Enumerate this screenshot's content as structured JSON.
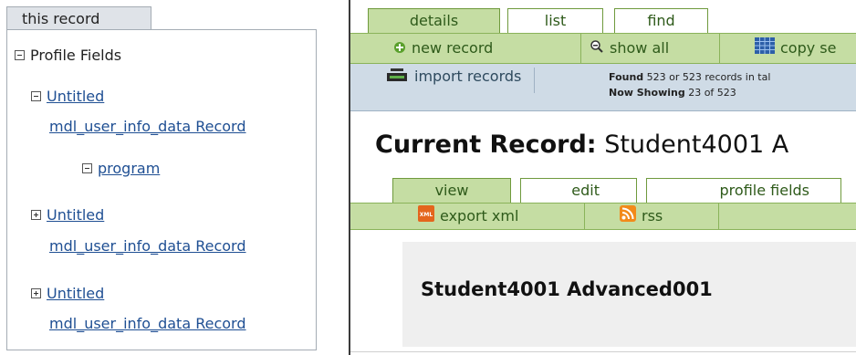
{
  "left_panel": {
    "tab_label": "this record",
    "root": {
      "label": "Profile Fields",
      "expander": "collapse-box-icon"
    },
    "items": [
      {
        "expander": "collapse-box-icon",
        "title": "Untitled",
        "subtitle": "mdl_user_info_data Record"
      },
      {
        "expander": "collapse-box-icon",
        "title": "program"
      },
      {
        "expander": "expand-box-icon",
        "title": "Untitled",
        "subtitle": "mdl_user_info_data Record"
      },
      {
        "expander": "expand-box-icon",
        "title": "Untitled",
        "subtitle": "mdl_user_info_data Record"
      }
    ]
  },
  "main_tabs": [
    {
      "label": "details",
      "active": true
    },
    {
      "label": "list",
      "active": false
    },
    {
      "label": "find",
      "active": false
    }
  ],
  "toolbar": {
    "new_record": "new record",
    "show_all": "show all",
    "copy": "copy se",
    "new_record_icon": "plus-circle-icon",
    "show_all_icon": "magnifier-minus-icon",
    "copy_icon": "spreadsheet-icon"
  },
  "status": {
    "import_label": "import records",
    "import_icon": "printer-tray-icon",
    "found_label": "Found",
    "found_text": "523 or 523 records in tal",
    "showing_label": "Now Showing",
    "showing_text": "23 of 523"
  },
  "title": {
    "label": "Current Record:",
    "value": "Student4001 A"
  },
  "sub_tabs": [
    {
      "label": "view",
      "active": true
    },
    {
      "label": "edit",
      "active": false
    },
    {
      "label": "profile fields",
      "active": false
    }
  ],
  "sub_toolbar": {
    "export_xml": "export xml",
    "export_icon": "xml-icon",
    "rss": "rss",
    "rss_icon": "rss-icon"
  },
  "record": {
    "name": "Student4001 Advanced001"
  },
  "colors": {
    "tab_green": "#c5dda3",
    "tab_border": "#6f9a3d",
    "status_blue": "#cfdbe6",
    "link": "#1f4f93"
  }
}
